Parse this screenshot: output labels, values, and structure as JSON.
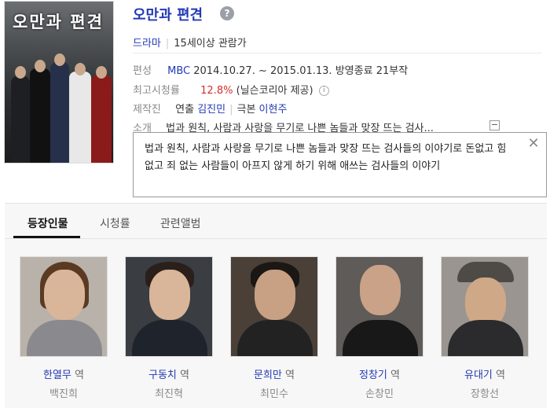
{
  "drama": {
    "title": "오만과 편견",
    "help_icon": "question-mark-icon",
    "genre": "드라마",
    "rating": "15세이상 관람가",
    "poster_title": "오만과 편견"
  },
  "info": {
    "schedule_label": "편성",
    "channel": "MBC",
    "period": "2014.10.27. ~ 2015.01.13.",
    "status": "방영종료",
    "episodes": "21부작",
    "peak_label": "최고시청률",
    "peak_value": "12.8%",
    "peak_source": "(닐슨코리아 제공)",
    "producer_label": "제작진",
    "director_role": "연출",
    "director": "김진민",
    "writer_role": "극본",
    "writer": "이현주",
    "intro_label": "소개",
    "intro_short": "법과 원칙, 사람과 사랑을 무기로 나쁜 놈들과 맞장 뜨는 검사...",
    "collapse_symbol": "−"
  },
  "popup": {
    "text": "법과 원칙, 사람과 사랑을 무기로 나쁜 놈들과 맞장 뜨는 검사들의 이야기로 돈없고 힘없고 죄 없는 사람들이 아프지 않게 하기 위해 애쓰는 검사들의 이야기",
    "close_symbol": "✕"
  },
  "tabs": [
    {
      "label": "등장인물",
      "active": true
    },
    {
      "label": "시청률",
      "active": false
    },
    {
      "label": "관련앨범",
      "active": false
    }
  ],
  "cast": [
    {
      "role": "한열무",
      "suffix": "역",
      "actor": "백진희"
    },
    {
      "role": "구동치",
      "suffix": "역",
      "actor": "최진혁"
    },
    {
      "role": "문희만",
      "suffix": "역",
      "actor": "최민수"
    },
    {
      "role": "정창기",
      "suffix": "역",
      "actor": "손창민"
    },
    {
      "role": "유대기",
      "suffix": "역",
      "actor": "장항선"
    }
  ]
}
